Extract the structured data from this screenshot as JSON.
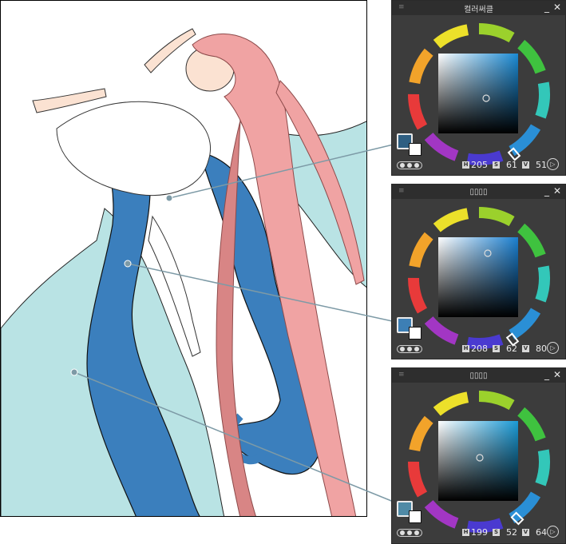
{
  "panels": [
    {
      "title": "컬러써클",
      "swatch_color": "#2f5f82",
      "indicator_color": "#dcdcdc",
      "hsv": {
        "h_label": "H",
        "h": "205",
        "s_label": "S",
        "s": "61",
        "v_label": "V",
        "v": "51"
      }
    },
    {
      "title": "▯▯▯▯",
      "swatch_color": "#3d7fb5",
      "indicator_color": "#dcdcdc",
      "hsv": {
        "h_label": "H",
        "h": "208",
        "s_label": "S",
        "s": "62",
        "v_label": "V",
        "v": "80"
      }
    },
    {
      "title": "▯▯▯▯",
      "swatch_color": "#4f8aa6",
      "indicator_color": "#dcdcdc",
      "hsv": {
        "h_label": "H",
        "h": "199",
        "s_label": "S",
        "s": "52",
        "v_label": "V",
        "v": "64"
      }
    }
  ],
  "controls": {
    "minimize": "_",
    "close": "✕",
    "grip": "≡",
    "play": "▷"
  },
  "colors": {
    "dress_dark": "#3b7fbd",
    "cape_light": "#b9e3e4",
    "hair": "#f0a3a3",
    "hair_shadow": "#d88585",
    "skin": "#fbe2d2",
    "leader_line": "#7d9aa6"
  }
}
